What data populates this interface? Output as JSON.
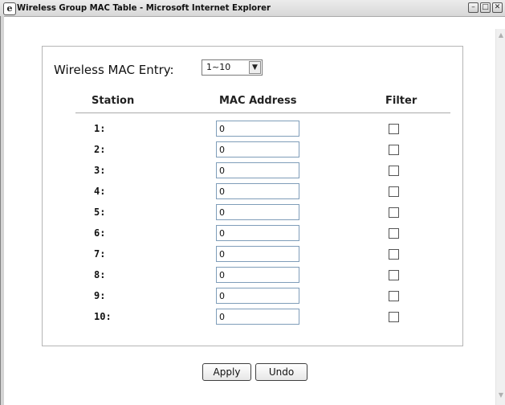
{
  "window": {
    "title": "Wireless Group MAC Table - Microsoft Internet Explorer",
    "controls": {
      "minimize": "–",
      "maximize": "□",
      "close": "✕"
    }
  },
  "form": {
    "entry_label": "Wireless MAC Entry:",
    "entry_select_value": "1~10",
    "columns": {
      "station": "Station",
      "mac": "MAC Address",
      "filter": "Filter"
    },
    "rows": [
      {
        "station": "1:",
        "mac": "0",
        "filter_checked": false
      },
      {
        "station": "2:",
        "mac": "0",
        "filter_checked": false
      },
      {
        "station": "3:",
        "mac": "0",
        "filter_checked": false
      },
      {
        "station": "4:",
        "mac": "0",
        "filter_checked": false
      },
      {
        "station": "5:",
        "mac": "0",
        "filter_checked": false
      },
      {
        "station": "6:",
        "mac": "0",
        "filter_checked": false
      },
      {
        "station": "7:",
        "mac": "0",
        "filter_checked": false
      },
      {
        "station": "8:",
        "mac": "0",
        "filter_checked": false
      },
      {
        "station": "9:",
        "mac": "0",
        "filter_checked": false
      },
      {
        "station": "10:",
        "mac": "0",
        "filter_checked": false
      }
    ]
  },
  "buttons": {
    "apply": "Apply",
    "undo": "Undo"
  },
  "icons": {
    "window_icon": "ie-page-icon",
    "select_arrow": "chevron-down-icon",
    "scroll_up": "arrow-up-icon",
    "scroll_down": "arrow-down-icon"
  }
}
